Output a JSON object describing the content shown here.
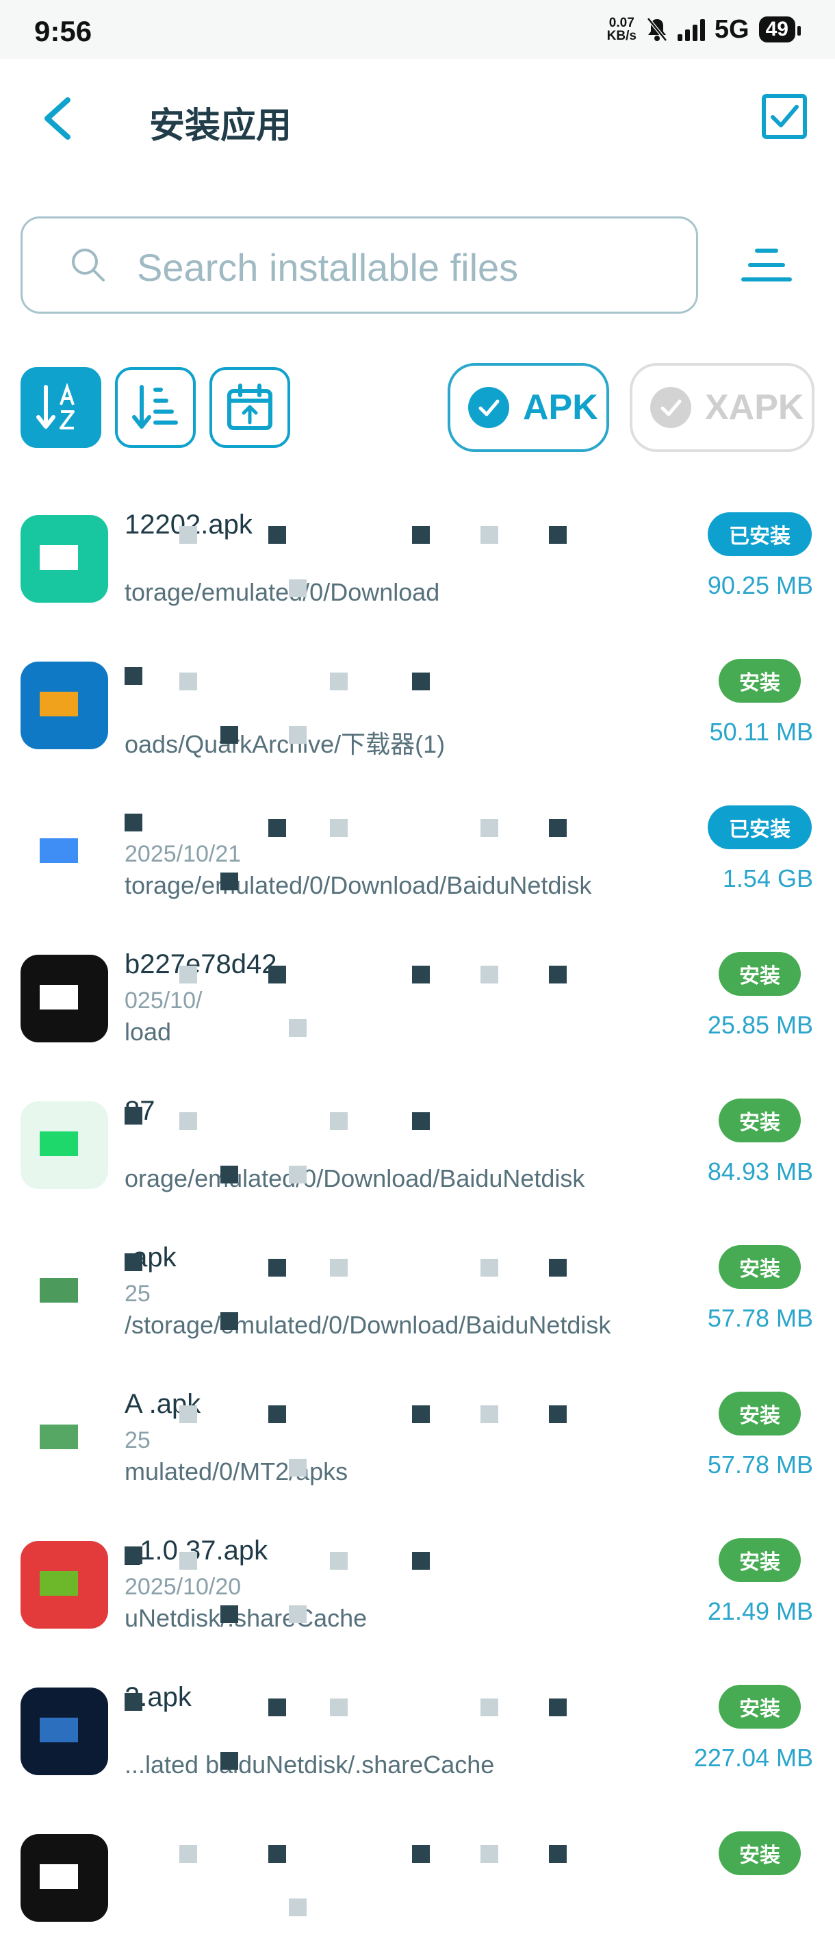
{
  "status": {
    "time": "9:56",
    "speed_value": "0.07",
    "speed_unit": "KB/s",
    "network": "5G",
    "battery": "49"
  },
  "header": {
    "title": "安装应用"
  },
  "search": {
    "placeholder": "Search installable files"
  },
  "type_filters": [
    {
      "label": "APK",
      "checked": true
    },
    {
      "label": "XAPK",
      "checked": false
    }
  ],
  "files": [
    {
      "name": "12202.apk",
      "date": "",
      "path": "torage/emulated/0/Download",
      "badge": "已安装",
      "badge_type": "installed",
      "size": "90.25 MB",
      "icon": [
        "#18c6a0",
        "#ffffff"
      ]
    },
    {
      "name": "",
      "date": "",
      "path": "oads/QuarkArchive/下载器(1)",
      "badge": "安装",
      "badge_type": "install",
      "size": "50.11 MB",
      "icon": [
        "#1079c6",
        "#f0a21c"
      ]
    },
    {
      "name": "",
      "date": "2025/10/21",
      "path": "torage/emulated/0/Download/BaiduNetdisk",
      "badge": "已安装",
      "badge_type": "installed",
      "size": "1.54 GB",
      "icon": [
        "#ffffff",
        "#3f8ef5"
      ]
    },
    {
      "name": "b227e78d42",
      "date": "025/10/",
      "path": "load",
      "badge": "安装",
      "badge_type": "install",
      "size": "25.85 MB",
      "icon": [
        "#111111",
        "#ffffff"
      ]
    },
    {
      "name": "87",
      "date": "",
      "path": "orage/emulated/0/Download/BaiduNetdisk",
      "badge": "安装",
      "badge_type": "install",
      "size": "84.93 MB",
      "icon": [
        "#e8f7ee",
        "#1fd86b"
      ]
    },
    {
      "name": ".apk",
      "date": "25",
      "path": "/storage/emulated/0/Download/BaiduNetdisk",
      "badge": "安装",
      "badge_type": "install",
      "size": "57.78 MB",
      "icon": [
        "#ffffff",
        "#4c9a5c"
      ]
    },
    {
      "name": "A .apk",
      "date": "25",
      "path": "mulated/0/MT2/apks",
      "badge": "安装",
      "badge_type": "install",
      "size": "57.78 MB",
      "icon": [
        "#ffffff",
        "#55a763"
      ]
    },
    {
      "name": "_1.0.37.apk",
      "date": "2025/10/20",
      "path": "uNetdisk/.shareCache",
      "badge": "安装",
      "badge_type": "install",
      "size": "21.49 MB",
      "icon": [
        "#e33b3b",
        "#6cb82a"
      ]
    },
    {
      "name": "2.apk",
      "date": "",
      "path": "...lated baiduNetdisk/.shareCache",
      "badge": "安装",
      "badge_type": "install",
      "size": "227.04 MB",
      "icon": [
        "#0b1b34",
        "#2c6fbf"
      ]
    },
    {
      "name": "",
      "date": "",
      "path": "",
      "badge": "安装",
      "badge_type": "install",
      "size": "",
      "icon": [
        "#111111",
        "#ffffff"
      ]
    }
  ]
}
